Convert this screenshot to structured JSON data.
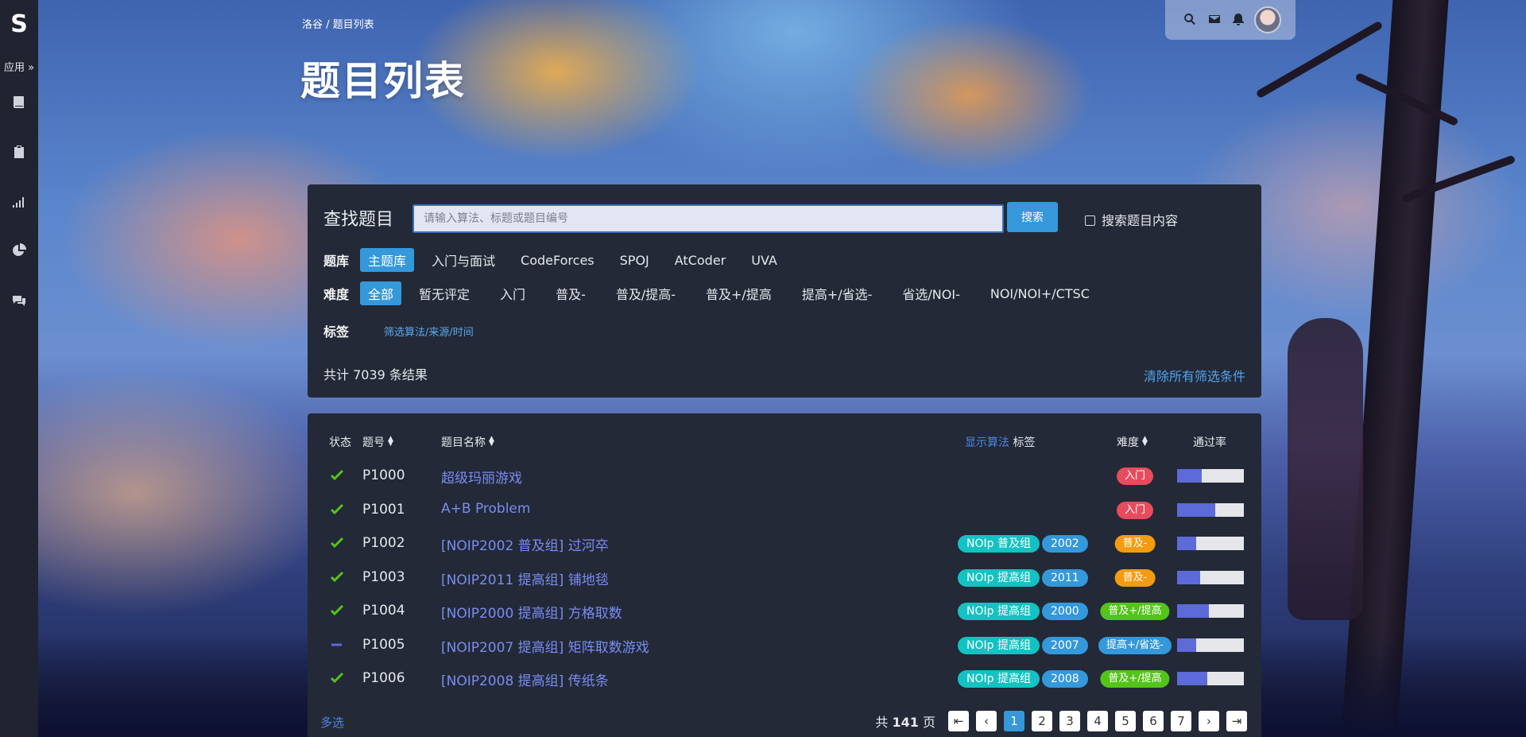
{
  "sidebar": {
    "logo": "S",
    "apps_label": "应用",
    "icons": [
      "book-icon",
      "clipboard-icon",
      "signal-bars-icon",
      "pie-chart-icon",
      "comments-icon"
    ]
  },
  "header": {
    "breadcrumb": "洛谷 / 题目列表",
    "title": "题目列表"
  },
  "user_bar": {
    "icons": [
      "search-icon",
      "envelope-icon",
      "bell-icon"
    ]
  },
  "search": {
    "label": "查找题目",
    "placeholder": "请输入算法、标题或题目编号",
    "button": "搜索",
    "content_option": "搜索题目内容"
  },
  "filters": {
    "bank_label": "题库",
    "banks": [
      "主题库",
      "入门与面试",
      "CodeForces",
      "SPOJ",
      "AtCoder",
      "UVA"
    ],
    "difficulty_label": "难度",
    "difficulties": [
      "全部",
      "暂无评定",
      "入门",
      "普及-",
      "普及/提高-",
      "普及+/提高",
      "提高+/省选-",
      "省选/NOI-",
      "NOI/NOI+/CTSC"
    ],
    "tag_label": "标签",
    "tag_filter": "筛选算法/来源/时间",
    "result_count": "共计 7039 条结果",
    "clear": "清除所有筛选条件"
  },
  "table": {
    "headers": {
      "status": "状态",
      "pid": "题号",
      "title": "题目名称",
      "show_algo": "显示算法",
      "tags": "标签",
      "difficulty": "难度",
      "pass_rate": "通过率"
    },
    "rows": [
      {
        "status": "accepted",
        "pid": "P1000",
        "title": "超级玛丽游戏",
        "tags": [],
        "difficulty": "入门",
        "difficulty_color": "#e74c5e",
        "pass_rate": 0.37
      },
      {
        "status": "accepted",
        "pid": "P1001",
        "title": "A+B Problem",
        "tags": [],
        "difficulty": "入门",
        "difficulty_color": "#e74c5e",
        "pass_rate": 0.57
      },
      {
        "status": "accepted",
        "pid": "P1002",
        "title": "[NOIP2002 普及组] 过河卒",
        "tags": [
          "NOIp 普及组",
          "2002"
        ],
        "difficulty": "普及-",
        "difficulty_color": "#f39c11",
        "pass_rate": 0.28
      },
      {
        "status": "accepted",
        "pid": "P1003",
        "title": "[NOIP2011 提高组] 铺地毯",
        "tags": [
          "NOIp 提高组",
          "2011"
        ],
        "difficulty": "普及-",
        "difficulty_color": "#f39c11",
        "pass_rate": 0.34
      },
      {
        "status": "accepted",
        "pid": "P1004",
        "title": "[NOIP2000 提高组] 方格取数",
        "tags": [
          "NOIp 提高组",
          "2000"
        ],
        "difficulty": "普及+/提高",
        "difficulty_color": "#52c41a",
        "pass_rate": 0.48
      },
      {
        "status": "attempted",
        "pid": "P1005",
        "title": "[NOIP2007 提高组] 矩阵取数游戏",
        "tags": [
          "NOIp 提高组",
          "2007"
        ],
        "difficulty": "提高+/省选-",
        "difficulty_color": "#3498db",
        "pass_rate": 0.28
      },
      {
        "status": "accepted",
        "pid": "P1006",
        "title": "[NOIP2008 提高组] 传纸条",
        "tags": [
          "NOIp 提高组",
          "2008"
        ],
        "difficulty": "普及+/提高",
        "difficulty_color": "#52c41a",
        "pass_rate": 0.45
      }
    ],
    "tag_colors": {
      "contest": "#13c2c2",
      "year": "#3498db"
    }
  },
  "footer": {
    "multi_select": "多选",
    "total_prefix": "共",
    "total_pages": "141",
    "total_suffix": "页",
    "pages": [
      "1",
      "2",
      "3",
      "4",
      "5",
      "6",
      "7"
    ],
    "current_page": "1"
  },
  "colors": {
    "accent": "#3498db",
    "link": "#7a8cf2",
    "accepted": "#52c41a",
    "attempted": "#5c6bd8",
    "card": "#232936"
  }
}
